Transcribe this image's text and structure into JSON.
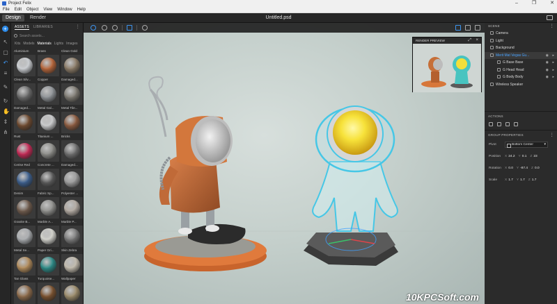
{
  "window": {
    "title": "Project Felix",
    "controls": [
      "–",
      "❐",
      "✕"
    ]
  },
  "menu": [
    "File",
    "Edit",
    "Object",
    "View",
    "Window",
    "Help"
  ],
  "top": {
    "tabs": [
      "Design",
      "Render"
    ],
    "document_title": "Untitled.psd"
  },
  "assets": {
    "tabs": [
      "ASSETS",
      "LIBRARIES"
    ],
    "search_placeholder": "Search assets...",
    "filters": [
      "Kits",
      "Models",
      "Materials",
      "Lights",
      "Images"
    ],
    "active_filter": "Materials",
    "items": [
      {
        "label": "Aluminium",
        "color": "#9aa0a6",
        "cut": true
      },
      {
        "label": "Brass",
        "color": "#b99a52",
        "cut": true
      },
      {
        "label": "Clean Gold",
        "color": "#d8b03d",
        "cut": true
      },
      {
        "label": "Clean Silv...",
        "color": "#c9ccd0"
      },
      {
        "label": "Copper",
        "color": "#b5653a"
      },
      {
        "label": "Damaged...",
        "color": "#8a7a66"
      },
      {
        "label": "Damaged...",
        "color": "#6b6b6b"
      },
      {
        "label": "Metal Gal...",
        "color": "#8f9397"
      },
      {
        "label": "Metal Tile...",
        "color": "#7e7a72"
      },
      {
        "label": "Rust",
        "color": "#6e4a30"
      },
      {
        "label": "Titanium ...",
        "color": "#c7c8c9"
      },
      {
        "label": "Bricks",
        "color": "#8a5a3f"
      },
      {
        "label": "Cerise Red",
        "color": "#c22a55"
      },
      {
        "label": "Concrete ...",
        "color": "#8c8c88"
      },
      {
        "label": "Damaged...",
        "color": "#6f6f6f"
      },
      {
        "label": "Denim",
        "color": "#3c5e8c"
      },
      {
        "label": "Fabric Sp...",
        "color": "#5a5a5a"
      },
      {
        "label": "Polyester ...",
        "color": "#9a9a9a"
      },
      {
        "label": "Granite B...",
        "color": "#6e5a4c"
      },
      {
        "label": "Marble A...",
        "color": "#8f8f8c"
      },
      {
        "label": "Marble P...",
        "color": "#b0a8a0"
      },
      {
        "label": "Metal Se...",
        "color": "#a8abae"
      },
      {
        "label": "Paper Gri...",
        "color": "#cfcfc9"
      },
      {
        "label": "Skin Zebra",
        "color": "#7a7a7a"
      },
      {
        "label": "Tan Glass",
        "color": "#b08a5a"
      },
      {
        "label": "Turquoise...",
        "color": "#2d8a86"
      },
      {
        "label": "Wallpaper",
        "color": "#bfb8aa"
      },
      {
        "label": "",
        "color": "#8c6a4a"
      },
      {
        "label": "",
        "color": "#7a5230"
      },
      {
        "label": "",
        "color": "#9a8a6a"
      }
    ]
  },
  "viewport": {
    "render_preview_title": "RENDER PREVIEW",
    "watermark": "10KPCSoft.com"
  },
  "scene": {
    "title": "SCENE",
    "items": [
      {
        "label": "Camera",
        "indent": 0,
        "selected": false
      },
      {
        "label": "Light",
        "indent": 0,
        "selected": false
      },
      {
        "label": "Background",
        "indent": 0,
        "selected": false
      },
      {
        "label": "Merit Mat Vegas Gu...",
        "indent": 0,
        "selected": true
      },
      {
        "label": "G Base Base",
        "indent": 1,
        "selected": false
      },
      {
        "label": "G Head Head",
        "indent": 1,
        "selected": false
      },
      {
        "label": "G Body Body",
        "indent": 1,
        "selected": false
      },
      {
        "label": "Wireless Speaker",
        "indent": 0,
        "selected": false
      }
    ]
  },
  "actions": {
    "title": "ACTIONS"
  },
  "group_properties": {
    "title": "GROUP PROPERTIES",
    "pivot_label": "Pivot",
    "pivot_value": "Bottom Center",
    "position_label": "Position",
    "position": {
      "x": "24.2",
      "y": "0.1",
      "z": "23"
    },
    "rotation_label": "Rotation",
    "rotation": {
      "x": "0.0",
      "y": "-87.4",
      "z": "0.0"
    },
    "scale_label": "Scale",
    "scale": {
      "x": "1.7",
      "y": "1.7",
      "z": "1.7"
    }
  },
  "colors": {
    "accent": "#2d8ceb",
    "panel": "#2b2b2b",
    "viewport_bg": "#c9d3cf"
  }
}
